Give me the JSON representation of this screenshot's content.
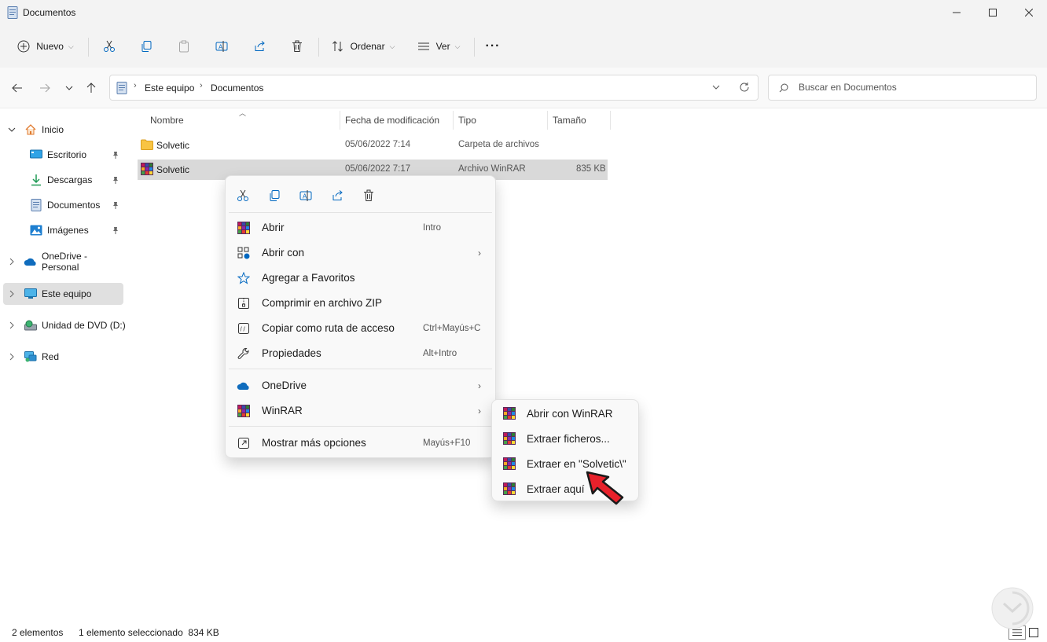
{
  "window": {
    "title": "Documentos"
  },
  "toolbar": {
    "new_label": "Nuevo",
    "sort_label": "Ordenar",
    "view_label": "Ver",
    "more_label": "···"
  },
  "address": {
    "breadcrumb": [
      "Este equipo",
      "Documentos"
    ],
    "search_placeholder": "Buscar en Documentos"
  },
  "sidebar": {
    "items": [
      {
        "label": "Inicio",
        "icon": "home-icon"
      },
      {
        "label": "Escritorio",
        "icon": "desktop-icon",
        "pinned": true
      },
      {
        "label": "Descargas",
        "icon": "download-icon",
        "pinned": true
      },
      {
        "label": "Documentos",
        "icon": "document-icon",
        "pinned": true
      },
      {
        "label": "Imágenes",
        "icon": "pictures-icon",
        "pinned": true
      },
      {
        "label": "OneDrive - Personal",
        "icon": "cloud-icon"
      },
      {
        "label": "Este equipo",
        "icon": "computer-icon",
        "selected": true
      },
      {
        "label": "Unidad de DVD (D:)",
        "icon": "dvd-icon"
      },
      {
        "label": "Red",
        "icon": "network-icon"
      }
    ]
  },
  "filelist": {
    "columns": [
      "Nombre",
      "Fecha de modificación",
      "Tipo",
      "Tamaño"
    ],
    "rows": [
      {
        "name": "Solvetic",
        "date": "05/06/2022 7:14",
        "type": "Carpeta de archivos",
        "size": "",
        "icon": "folder-icon"
      },
      {
        "name": "Solvetic",
        "date": "05/06/2022 7:17",
        "type": "Archivo WinRAR",
        "size": "835 KB",
        "icon": "winrar-icon",
        "selected": true
      }
    ]
  },
  "context_menu": {
    "quick_actions": [
      "cut-icon",
      "copy-icon",
      "rename-icon",
      "share-icon",
      "delete-icon"
    ],
    "items": [
      {
        "label": "Abrir",
        "shortcut": "Intro",
        "icon": "winrar-icon"
      },
      {
        "label": "Abrir con",
        "submenu": true,
        "icon": "open-with-icon"
      },
      {
        "label": "Agregar a Favoritos",
        "icon": "star-icon"
      },
      {
        "label": "Comprimir en archivo ZIP",
        "icon": "zip-icon"
      },
      {
        "label": "Copiar como ruta de acceso",
        "shortcut": "Ctrl+Mayús+C",
        "icon": "copy-path-icon"
      },
      {
        "label": "Propiedades",
        "shortcut": "Alt+Intro",
        "icon": "wrench-icon"
      },
      {
        "label": "OneDrive",
        "submenu": true,
        "icon": "cloud-icon"
      },
      {
        "label": "WinRAR",
        "submenu": true,
        "icon": "winrar-icon"
      },
      {
        "label": "Mostrar más opciones",
        "shortcut": "Mayús+F10",
        "icon": "more-options-icon"
      }
    ]
  },
  "winrar_submenu": {
    "items": [
      {
        "label": "Abrir con WinRAR"
      },
      {
        "label": "Extraer ficheros..."
      },
      {
        "label": "Extraer en \"Solvetic\\\""
      },
      {
        "label": "Extraer aquí"
      }
    ]
  },
  "statusbar": {
    "count": "2 elementos",
    "selection": "1 elemento seleccionado  834 KB"
  },
  "colors": {
    "accent": "#0067c0",
    "selection": "#cce4f7",
    "sidebar_selected": "#e0e0e0",
    "folder": "#f8c443",
    "pointer_arrow": "#e8212b"
  }
}
